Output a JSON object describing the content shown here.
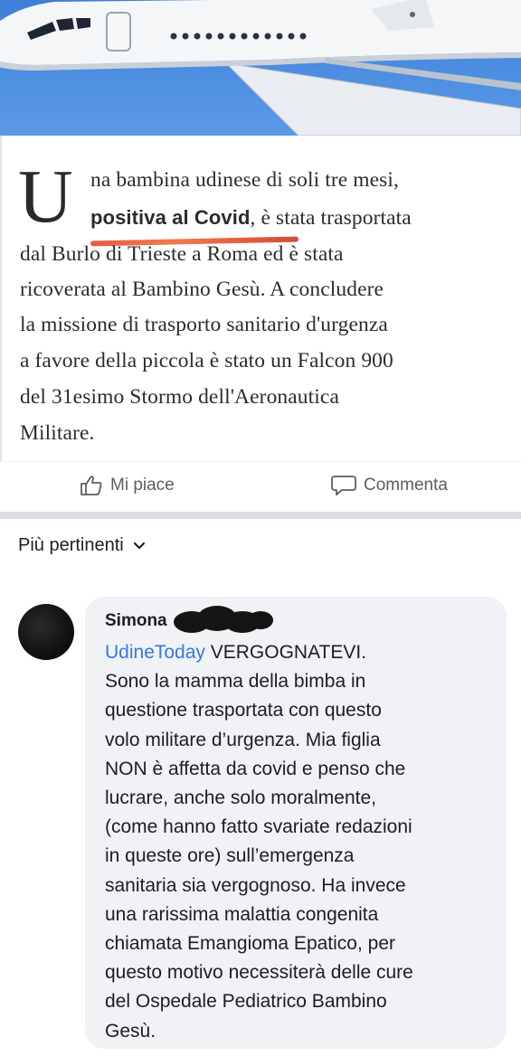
{
  "article": {
    "dropcap": "U",
    "lines": [
      "na bambina udinese di soli tre mesi,",
      "è stata trasportata",
      "dal Burlo di Trieste a Roma ed è stata",
      "ricoverata al Bambino Gesù. A concludere",
      "la missione di trasporto sanitario d'urgenza",
      "a favore della piccola è stato un Falcon 900",
      "del 31esimo Stormo dell'Aeronautica",
      "Militare."
    ],
    "bold_phrase": "positiva al Covid",
    "comma": ","
  },
  "actions": {
    "like_label": "Mi piace",
    "comment_label": "Commenta"
  },
  "sort": {
    "label": "Più pertinenti"
  },
  "comment": {
    "author": "Simona",
    "tag": "UdineToday",
    "lines": [
      "VERGOGNATEVI.",
      "Sono la mamma della bimba in",
      "questione trasportata con questo",
      "volo militare d’urgenza.  Mia figlia",
      "NON è affetta da covid e penso che",
      "lucrare, anche solo moralmente,",
      "(come hanno fatto svariate redazioni",
      "in queste ore) sull’emergenza",
      "sanitaria sia vergognoso. Ha invece",
      "una rarissima malattia congenita",
      "chiamata Emangioma Epatico, per",
      "questo motivo necessiterà delle cure",
      "del Ospedale Pediatrico Bambino",
      "Gesù."
    ]
  },
  "colors": {
    "link": "#3578e5",
    "underline": "#e24a2a",
    "sky": "#4e8ee0"
  }
}
